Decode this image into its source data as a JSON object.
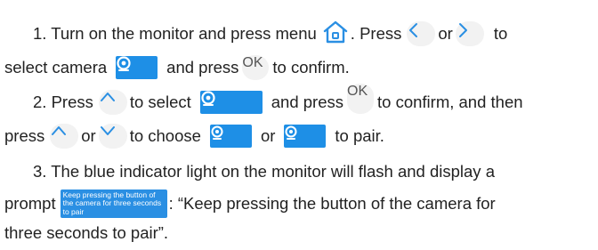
{
  "step1": {
    "a": "1. Turn on the monitor and press menu",
    "b": ". Press",
    "c": "or",
    "d": "to",
    "e": "select camera",
    "f": "and press",
    "g": "to confirm."
  },
  "step2": {
    "a": "2. Press",
    "b": "to select",
    "c": "and press",
    "d": "to confirm, and then",
    "e": "press",
    "f": "or",
    "g": "to choose",
    "h": "or",
    "i": "to pair."
  },
  "step3": {
    "a": "3. The blue indicator light on the monitor will flash and display a",
    "b": "prompt",
    "c": ": “Keep pressing the button of the camera for",
    "d": "three seconds to pair”."
  },
  "icons": {
    "ok_label": "OK",
    "add_camera_sup": "+",
    "camera1_sub": "1",
    "camera2_sub": "2",
    "prompt_text": "Keep pressing the button of the camera for three seconds to pair"
  },
  "colors": {
    "accent_blue": "#1e8fe6",
    "button_gray": "#f2f2f2",
    "text": "#222222"
  }
}
